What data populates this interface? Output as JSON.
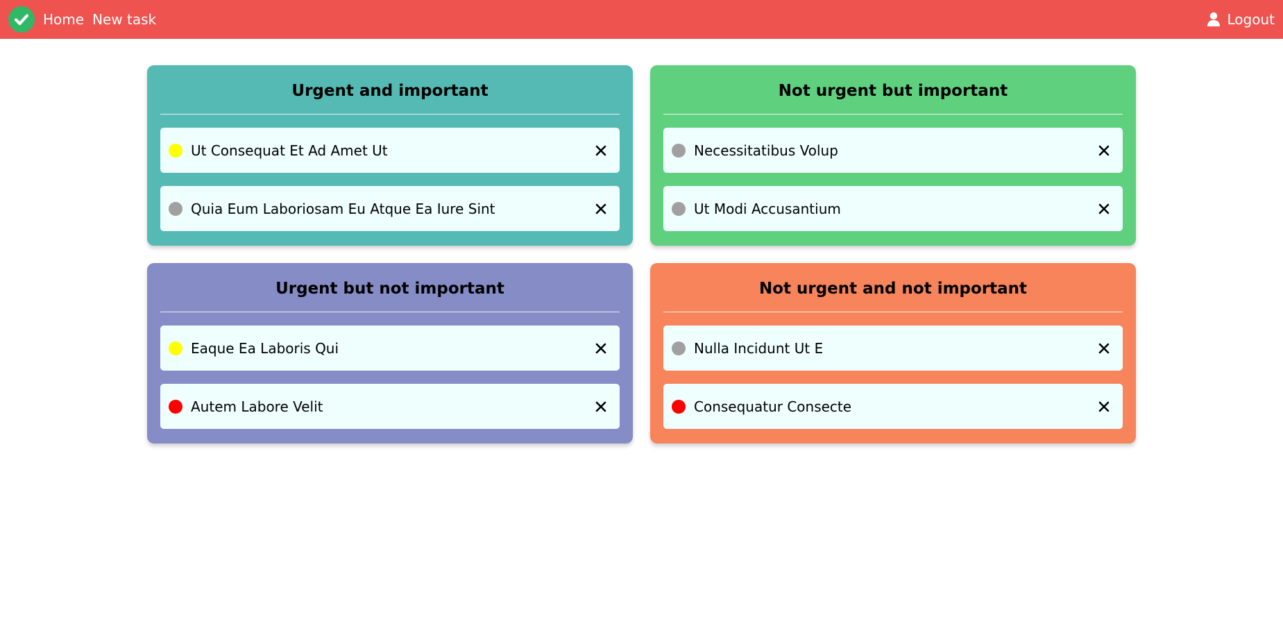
{
  "nav": {
    "home_label": "Home",
    "new_task_label": "New task",
    "logout_label": "Logout"
  },
  "colors": {
    "navbar": "#ef5350",
    "logo": "#2fb866",
    "q1": "#54bab3",
    "q2": "#5fd07e",
    "q3": "#858cc6",
    "q4": "#f7845b",
    "task_bg": "#eefffd",
    "priority_low": "#a0a0a0",
    "priority_medium": "#ffff00",
    "priority_high": "#ff0000"
  },
  "quadrants": [
    {
      "title": "Urgent and important",
      "color": "#54bab3",
      "tasks": [
        {
          "label": "Ut Consequat Et Ad Amet Ut",
          "priority_color": "#ffff00"
        },
        {
          "label": "Quia Eum Laboriosam Eu Atque Ea Iure Sint",
          "priority_color": "#a0a0a0"
        }
      ]
    },
    {
      "title": "Not urgent but important",
      "color": "#5fd07e",
      "tasks": [
        {
          "label": "Necessitatibus Volup",
          "priority_color": "#a0a0a0"
        },
        {
          "label": "Ut Modi Accusantium",
          "priority_color": "#a0a0a0"
        }
      ]
    },
    {
      "title": "Urgent but not important",
      "color": "#858cc6",
      "tasks": [
        {
          "label": "Eaque Ea Laboris Qui",
          "priority_color": "#ffff00"
        },
        {
          "label": "Autem Labore Velit",
          "priority_color": "#ff0000"
        }
      ]
    },
    {
      "title": "Not urgent and not important",
      "color": "#f7845b",
      "tasks": [
        {
          "label": "Nulla Incidunt Ut E",
          "priority_color": "#a0a0a0"
        },
        {
          "label": "Consequatur Consecte",
          "priority_color": "#ff0000"
        }
      ]
    }
  ],
  "icons": {
    "logo": "check-circle-icon",
    "logout": "user-icon",
    "delete": "close-icon"
  }
}
